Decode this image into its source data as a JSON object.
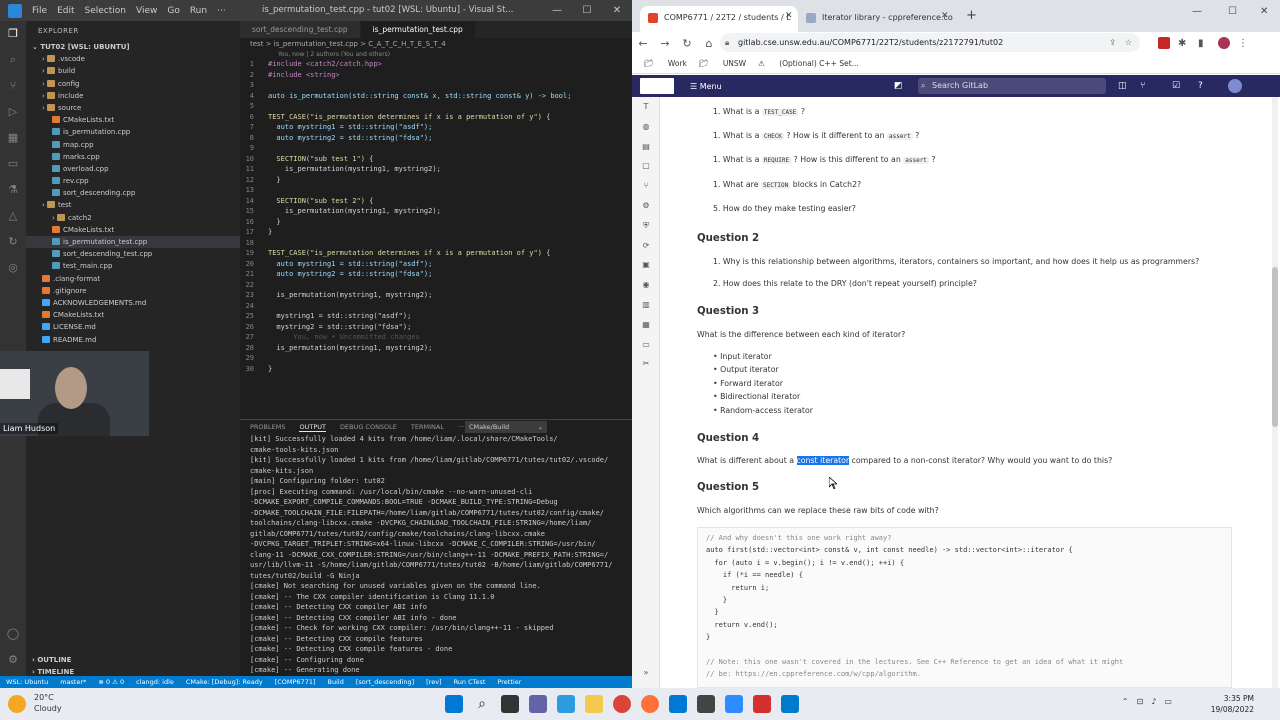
{
  "vscode": {
    "menu": [
      "File",
      "Edit",
      "Selection",
      "View",
      "Go",
      "Run",
      "···"
    ],
    "title": "is_permutation_test.cpp - tut02 [WSL: Ubuntu] - Visual St...",
    "explorer_title": "EXPLORER",
    "workspace": "TUT02 [WSL: UBUNTU]",
    "tree": [
      {
        "label": ".vscode",
        "indent": 1,
        "folder": true
      },
      {
        "label": "build",
        "indent": 1,
        "folder": true
      },
      {
        "label": "config",
        "indent": 1,
        "folder": true
      },
      {
        "label": "include",
        "indent": 1,
        "folder": true
      },
      {
        "label": "source",
        "indent": 1,
        "folder": true
      },
      {
        "label": "CMakeLists.txt",
        "indent": 2,
        "folder": false
      },
      {
        "label": "is_permutation.cpp",
        "indent": 2,
        "folder": false
      },
      {
        "label": "map.cpp",
        "indent": 2,
        "folder": false
      },
      {
        "label": "marks.cpp",
        "indent": 2,
        "folder": false
      },
      {
        "label": "overload.cpp",
        "indent": 2,
        "folder": false
      },
      {
        "label": "rev.cpp",
        "indent": 2,
        "folder": false
      },
      {
        "label": "sort_descending.cpp",
        "indent": 2,
        "folder": false
      },
      {
        "label": "test",
        "indent": 1,
        "folder": true
      },
      {
        "label": "catch2",
        "indent": 2,
        "folder": true
      },
      {
        "label": "CMakeLists.txt",
        "indent": 2,
        "folder": false
      },
      {
        "label": "is_permutation_test.cpp",
        "indent": 2,
        "folder": false,
        "selected": true
      },
      {
        "label": "sort_descending_test.cpp",
        "indent": 2,
        "folder": false
      },
      {
        "label": "test_main.cpp",
        "indent": 2,
        "folder": false
      },
      {
        "label": ".clang-format",
        "indent": 1,
        "folder": false
      },
      {
        "label": ".gitignore",
        "indent": 1,
        "folder": false
      },
      {
        "label": "ACKNOWLEDGEMENTS.md",
        "indent": 1,
        "folder": false
      },
      {
        "label": "CMakeLists.txt",
        "indent": 1,
        "folder": false
      },
      {
        "label": "LICENSE.md",
        "indent": 1,
        "folder": false
      },
      {
        "label": "README.md",
        "indent": 1,
        "folder": false
      }
    ],
    "outline": "OUTLINE",
    "timeline": "TIMELINE",
    "tabs": [
      "sort_descending_test.cpp",
      "is_permutation_test.cpp"
    ],
    "breadcrumb": "test > is_permutation_test.cpp > C_A_T_C_H_T_E_S_T_4",
    "blame": "You, now | 2 authors (You and others)",
    "code": [
      "#include <catch2/catch.hpp>",
      "#include <string>",
      "",
      "auto is_permutation(std::string const& x, std::string const& y) -> bool;",
      "",
      "TEST_CASE(\"is_permutation determines if x is a permutation of y\") {",
      "  auto mystring1 = std::string(\"asdf\");",
      "  auto mystring2 = std::string(\"fdsa\");",
      "",
      "  SECTION(\"sub test 1\") {",
      "    is_permutation(mystring1, mystring2);",
      "  }",
      "",
      "  SECTION(\"sub test 2\") {",
      "    is_permutation(mystring1, mystring2);",
      "  }",
      "}",
      "",
      "TEST_CASE(\"is_permutation determines if x is a permutation of y\") {",
      "  auto mystring1 = std::string(\"asdf\");",
      "  auto mystring2 = std::string(\"fdsa\");",
      "",
      "  is_permutation(mystring1, mystring2);",
      "",
      "  mystring1 = std::string(\"asdf\");",
      "  mystring2 = std::string(\"fdsa\");",
      "      You, now • Uncommitted changes",
      "  is_permutation(mystring1, mystring2);",
      "",
      "}"
    ],
    "panel_tabs": [
      "PROBLEMS",
      "OUTPUT",
      "DEBUG CONSOLE",
      "TERMINAL",
      "···"
    ],
    "panel_select": "CMake/Build",
    "output": [
      "[kit] Successfully loaded 4 kits from /home/liam/.local/share/CMakeTools/",
      "cmake-tools-kits.json",
      "[kit] Successfully loaded 1 kits from /home/liam/gitlab/COMP6771/tutes/tut02/.vscode/",
      "cmake-kits.json",
      "[main] Configuring folder: tut02",
      "[proc] Executing command: /usr/local/bin/cmake --no-warn-unused-cli",
      "-DCMAKE_EXPORT_COMPILE_COMMANDS:BOOL=TRUE -DCMAKE_BUILD_TYPE:STRING=Debug",
      "-DCMAKE_TOOLCHAIN_FILE:FILEPATH=/home/liam/gitlab/COMP6771/tutes/tut02/config/cmake/",
      "toolchains/clang-libcxx.cmake -DVCPKG_CHAINLOAD_TOOLCHAIN_FILE:STRING=/home/liam/",
      "gitlab/COMP6771/tutes/tut02/config/cmake/toolchains/clang-libcxx.cmake",
      "-DVCPKG_TARGET_TRIPLET:STRING=x64-linux-libcxx -DCMAKE_C_COMPILER:STRING=/usr/bin/",
      "clang-11 -DCMAKE_CXX_COMPILER:STRING=/usr/bin/clang++-11 -DCMAKE_PREFIX_PATH:STRING=/",
      "usr/lib/llvm-11 -S/home/liam/gitlab/COMP6771/tutes/tut02 -B/home/liam/gitlab/COMP6771/",
      "tutes/tut02/build -G Ninja",
      "[cmake] Not searching for unused variables given on the command line.",
      "[cmake] -- The CXX compiler identification is Clang 11.1.0",
      "[cmake] -- Detecting CXX compiler ABI info",
      "[cmake] -- Detecting CXX compiler ABI info - done",
      "[cmake] -- Check for working CXX compiler: /usr/bin/clang++-11 - skipped",
      "[cmake] -- Detecting CXX compile features",
      "[cmake] -- Detecting CXX compile features - done",
      "[cmake] -- Configuring done",
      "[cmake] -- Generating done"
    ],
    "status": [
      "WSL: Ubuntu",
      "master*",
      "⊗ 0 ⚠ 0",
      "clangd: idle",
      "CMake: [Debug]: Ready",
      "[COMP6771]",
      "Build",
      "[sort_descending]",
      "[rev]",
      "Run CTest",
      "Prettier"
    ],
    "webcam_name": "Liam Hudson"
  },
  "chrome": {
    "tabs": [
      "COMP6771 / 22T2 / students / L",
      "Iterator library - cppreference.co"
    ],
    "url": "gitlab.cse.unsw.edu.au/COMP6771/22T2/students/z2172791/tut02",
    "bookmarks": [
      "Work",
      "UNSW",
      "(Optional) C++ Set..."
    ],
    "gitlab_menu": "Menu",
    "search_placeholder": "Search GitLab"
  },
  "doc": {
    "q1_items": [
      [
        "1. What is a ",
        "TEST_CASE",
        " ?"
      ],
      [
        "1. What is a ",
        "CHECK",
        " ? How is it different to an ",
        "assert",
        " ?"
      ],
      [
        "1. What is a ",
        "REQUIRE",
        " ? How is this different to an ",
        "assert",
        " ?"
      ],
      [
        "1. What are ",
        "SECTION",
        " blocks in Catch2?"
      ],
      [
        "5. How do they make testing easier?"
      ]
    ],
    "q2": "Question 2",
    "q2_items": [
      "1. Why is this relationship between algorithms, iterators, containers so important, and how does it help us as programmers?",
      "2. How does this relate to the DRY (don't repeat yourself) principle?"
    ],
    "q3": "Question 3",
    "q3_text": "What is the difference between each kind of iterator?",
    "q3_items": [
      "Input iterator",
      "Output iterator",
      "Forward iterator",
      "Bidirectional iterator",
      "Random-access iterator"
    ],
    "q4": "Question 4",
    "q4_pre": "What is different about a ",
    "q4_hl": "const iterator",
    "q4_post": " compared to a non-const iterator? Why would you want to do this?",
    "q5": "Question 5",
    "q5_text": "Which algorithms can we replace these raw bits of code with?",
    "code": [
      "// And why doesn't this one work right away?",
      "auto first(std::vector<int> const& v, int const needle) -> std::vector<int>::iterator {",
      "  for (auto i = v.begin(); i != v.end(); ++i) {",
      "    if (*i == needle) {",
      "      return i;",
      "    }",
      "  }",
      "  return v.end();",
      "}",
      "",
      "// Note: this one wasn't covered in the lectures. See C++ Reference to get an idea of what it might",
      "// be: https://en.cppreference.com/w/cpp/algorithm."
    ]
  },
  "taskbar": {
    "temp": "20°C",
    "weather": "Cloudy",
    "time": "3:35 PM",
    "date": "19/08/2022"
  }
}
